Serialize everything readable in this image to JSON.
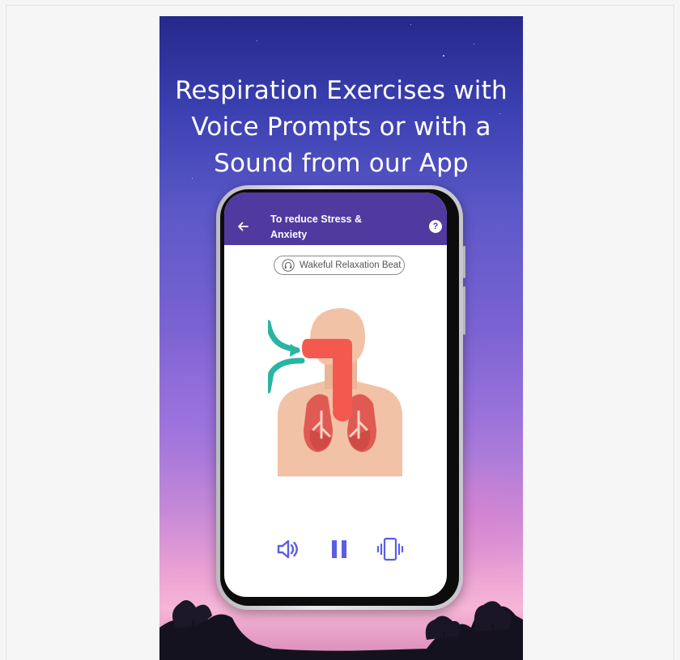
{
  "promo": {
    "headline_lines": [
      "Respiration Exercises with",
      "Voice Prompts or with a",
      "Sound from our App"
    ]
  },
  "app": {
    "title": "To reduce Stress & Anxiety",
    "sound_chip": "Wakeful Relaxation Beat",
    "help_glyph": "?",
    "icons": [
      "back-arrow-icon",
      "help-icon",
      "headphones-icon",
      "respiratory-system-illustration",
      "speaker-icon",
      "pause-icon",
      "vibrate-icon"
    ],
    "colors": {
      "appbar": "#503aa0",
      "controls": "#5a5fe0"
    }
  }
}
